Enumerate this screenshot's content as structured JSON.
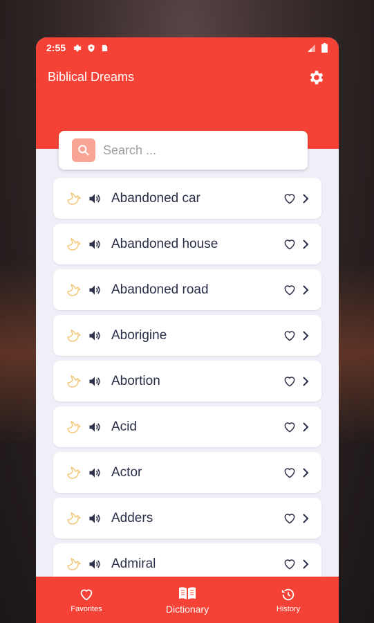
{
  "status_bar": {
    "time": "2:55"
  },
  "header": {
    "title": "Biblical Dreams",
    "settings_icon": "gear-icon"
  },
  "search": {
    "placeholder": "Search ..."
  },
  "list": {
    "items": [
      {
        "label": "Abandoned car"
      },
      {
        "label": "Abandoned house"
      },
      {
        "label": "Abandoned road"
      },
      {
        "label": "Aborigine"
      },
      {
        "label": "Abortion"
      },
      {
        "label": "Acid"
      },
      {
        "label": "Actor"
      },
      {
        "label": "Adders"
      },
      {
        "label": "Admiral"
      }
    ]
  },
  "bottom_nav": {
    "items": [
      {
        "label": "Favorites",
        "icon": "heart-icon"
      },
      {
        "label": "Dictionary",
        "icon": "book-icon",
        "active": true
      },
      {
        "label": "History",
        "icon": "history-icon"
      }
    ]
  },
  "colors": {
    "accent": "#f44336",
    "dove": "#f3c77a",
    "text": "#2a2f47",
    "background": "#efeff8"
  }
}
